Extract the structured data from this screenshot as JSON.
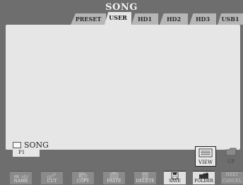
{
  "screen": {
    "title": "SONG"
  },
  "tabs": [
    {
      "label": "PRESET",
      "active": false
    },
    {
      "label": "USER",
      "active": true
    },
    {
      "label": "HD1",
      "active": false
    },
    {
      "label": "HD2",
      "active": false
    },
    {
      "label": "HD3",
      "active": false
    },
    {
      "label": "USB1",
      "active": false
    }
  ],
  "list": {
    "item_label": "SONG",
    "page_label": "P1"
  },
  "side_buttons": {
    "view_label": "VIEW",
    "up_label": "UP"
  },
  "function_buttons": [
    {
      "label": "NAME",
      "icon": "rename-icon",
      "enabled": false
    },
    {
      "label": "CUT",
      "icon": "scissors-icon",
      "enabled": false
    },
    {
      "label": "COPY",
      "icon": "copy-icon",
      "enabled": false
    },
    {
      "label": "PASTE",
      "icon": "paste-icon",
      "enabled": false
    },
    {
      "label": "DELETE",
      "icon": "trash-icon",
      "enabled": false
    },
    {
      "label": "SAVE",
      "icon": "floppy-icon",
      "enabled": true
    },
    {
      "label": "FOLDER",
      "icon": "new-folder-icon",
      "enabled": true
    },
    {
      "label": "NEXT",
      "label2": "CANCEL",
      "icon": "",
      "enabled": false
    }
  ],
  "colors": {
    "background": "#6e6e6e",
    "panel": "#e6e6e6",
    "tab_inactive": "#b6b6b6"
  }
}
